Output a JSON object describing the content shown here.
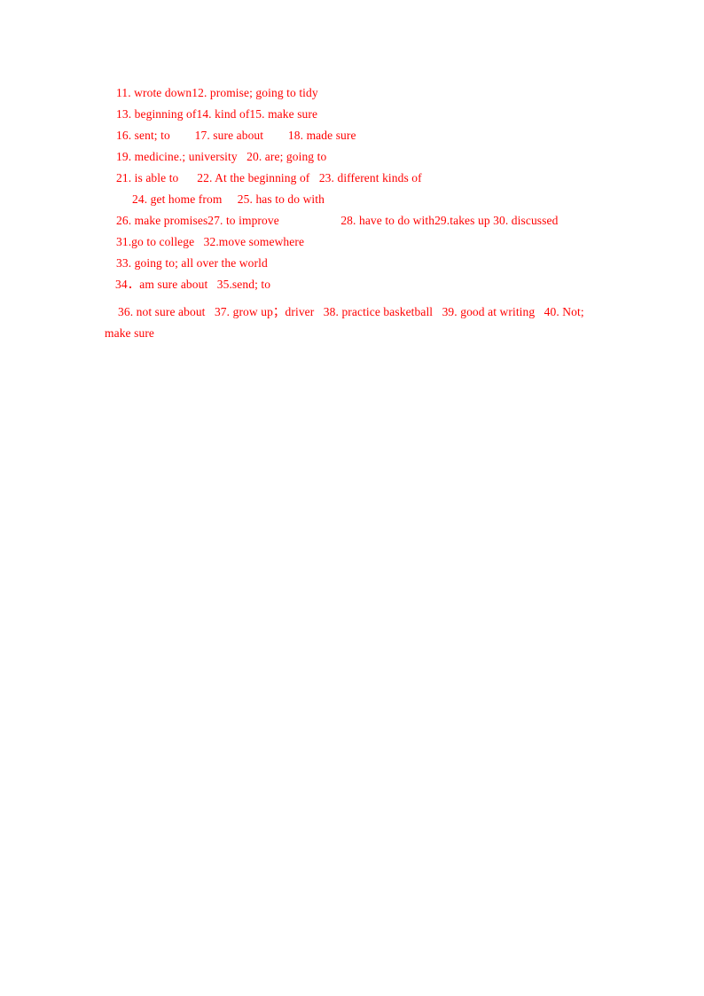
{
  "document": {
    "type": "answer-key",
    "text_color": "#ff0000",
    "background_color": "#ffffff",
    "lines": [
      {
        "id": "line-11-12",
        "text": "11. wrote down12. promise; going to tidy"
      },
      {
        "id": "line-13-15",
        "text": "13. beginning of14. kind of15. make sure"
      },
      {
        "id": "line-16-18",
        "text": "16. sent; to        17. sure about        18. made sure"
      },
      {
        "id": "line-19-20",
        "text": "19. medicine.; university   20. are; going to"
      },
      {
        "id": "line-21-23",
        "text": "21. is able to      22. At the beginning of   23. different kinds of"
      },
      {
        "id": "line-24-25",
        "text": "24. get home from     25. has to do with"
      },
      {
        "id": "line-26-30",
        "text": "26. make promises27. to improve                    28. have to do with29.takes up 30. discussed"
      },
      {
        "id": "line-31-32",
        "text": "31.go to college   32.move somewhere"
      },
      {
        "id": "line-33",
        "text": "33. going to; all over the world"
      },
      {
        "id": "line-34-35",
        "text": "34．am sure about   35.send; to"
      },
      {
        "id": "line-36-40",
        "text": "36. not sure about   37. grow up；driver   38. practice basketball   39. good at writing   40. Not;"
      },
      {
        "id": "line-40-cont",
        "text": "make sure"
      }
    ]
  }
}
